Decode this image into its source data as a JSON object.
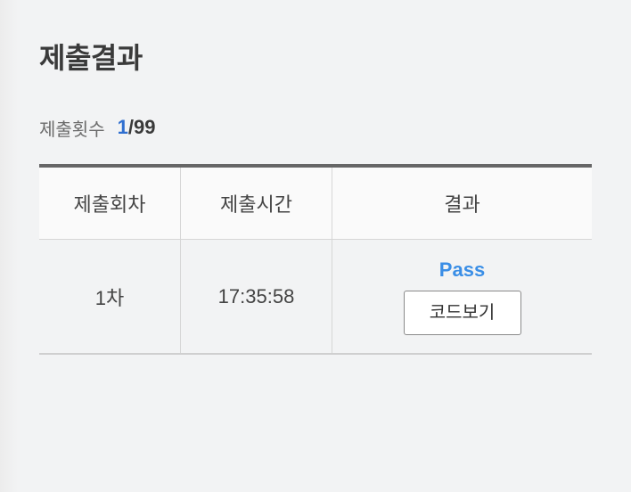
{
  "title": "제출결과",
  "submission_count": {
    "label": "제출횟수",
    "current": "1",
    "separator": "/",
    "total": "99"
  },
  "table": {
    "headers": [
      "제출회차",
      "제출시간",
      "결과"
    ],
    "rows": [
      {
        "round": "1차",
        "time": "17:35:58",
        "result": "Pass",
        "button_label": "코드보기"
      }
    ]
  },
  "colors": {
    "accent_count": "#2f6fd0",
    "pass": "#3a8ee6",
    "table_top_border": "#666666"
  }
}
